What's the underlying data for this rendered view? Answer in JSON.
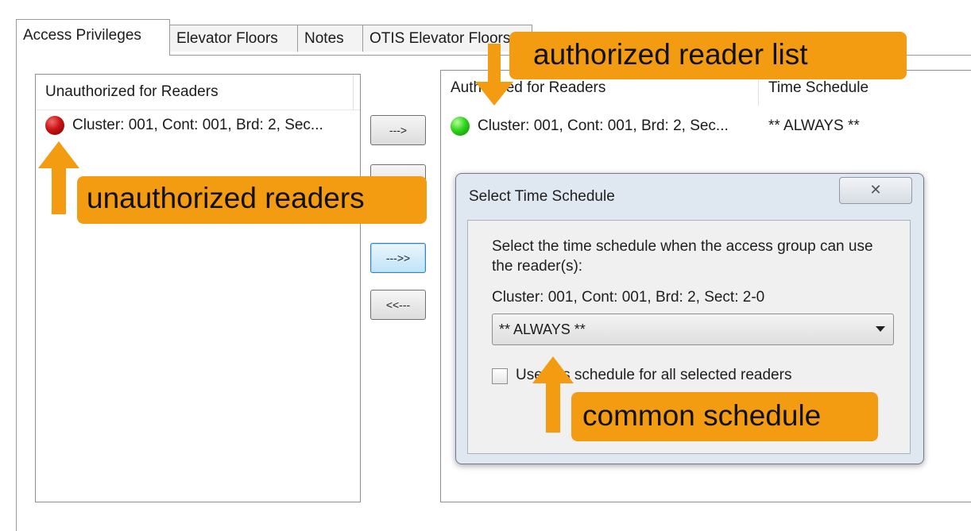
{
  "tabs": [
    "Access Privileges",
    "Elevator Floors",
    "Notes",
    "OTIS Elevator Floors"
  ],
  "left_list": {
    "header": "Unauthorized for Readers",
    "rows": [
      {
        "text": "Cluster: 001, Cont: 001, Brd: 2, Sec...",
        "status": "unauthorized"
      }
    ]
  },
  "transfer_buttons": [
    "--->",
    "",
    "--->>",
    "<<---"
  ],
  "right_list": {
    "headers": [
      "Authorized for Readers",
      "Time Schedule"
    ],
    "rows": [
      {
        "text": "Cluster: 001, Cont: 001, Brd: 2, Sec...",
        "schedule": "** ALWAYS **",
        "status": "authorized"
      }
    ]
  },
  "dialog": {
    "title": "Select Time Schedule",
    "close_glyph": "✕",
    "prompt": "Select the time schedule when the access group can use the reader(s):",
    "reader": "Cluster: 001, Cont: 001, Brd: 2, Sect: 2-0",
    "schedule_value": "** ALWAYS **",
    "checkbox_label": "Use this schedule for all selected readers",
    "checkbox_checked": false
  },
  "callouts": {
    "authorized": "authorized reader list",
    "unauthorized": "unauthorized readers",
    "common": "common schedule"
  },
  "colors": {
    "callout": "#f39c12",
    "status_unauthorized": "#c81414",
    "status_authorized": "#2ed51a"
  }
}
